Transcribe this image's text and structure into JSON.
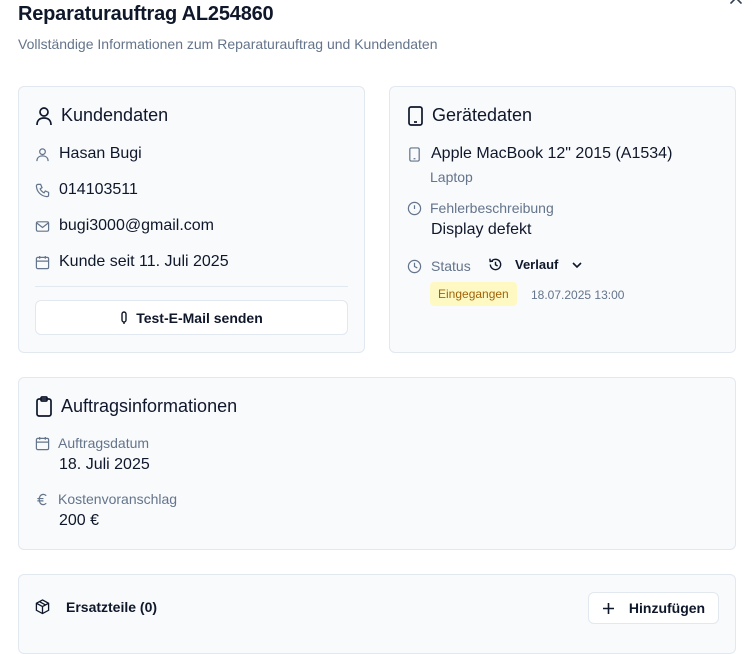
{
  "dialog": {
    "title": "Reparaturauftrag AL254860",
    "subtitle": "Vollständige Informationen zum Reparaturauftrag und Kundendaten"
  },
  "customer": {
    "heading": "Kundendaten",
    "name": "Hasan Bugi",
    "phone": "014103511",
    "email": "bugi3000@gmail.com",
    "since": "Kunde seit 11. Juli 2025",
    "test_email_button": "Test-E-Mail senden"
  },
  "device": {
    "heading": "Gerätedaten",
    "model": "Apple MacBook 12\" 2015 (A1534)",
    "type": "Laptop",
    "fault_label": "Fehlerbeschreibung",
    "fault_value": "Display defekt",
    "status_label": "Status",
    "history_button": "Verlauf",
    "status_badge": "Eingegangen",
    "status_timestamp": "18.07.2025 13:00"
  },
  "order": {
    "heading": "Auftragsinformationen",
    "date_label": "Auftragsdatum",
    "date_value": "18. Juli 2025",
    "estimate_label": "Kostenvoranschlag",
    "estimate_value": "200 €"
  },
  "parts": {
    "heading": "Ersatzteile (0)",
    "add_button": "Hinzufügen"
  },
  "colors": {
    "badge_bg": "#fef9c3",
    "badge_text": "#a16207",
    "card_bg": "#f8fafc",
    "border": "#e2e8f0",
    "muted": "#64748b"
  }
}
